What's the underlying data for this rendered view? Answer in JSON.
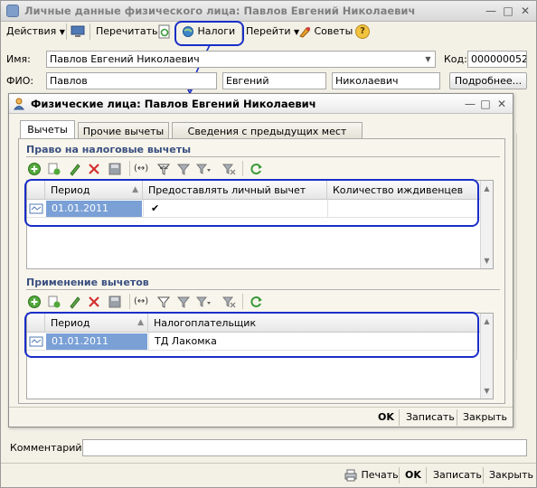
{
  "outer_window": {
    "title": "Личные данные физического лица: Павлов Евгений Николаевич",
    "toolbar": {
      "actions": "Действия",
      "reread": "Перечитать",
      "taxes": "Налоги",
      "go": "Перейти",
      "tips": "Советы",
      "help": "?"
    },
    "name_label": "Имя:",
    "name_value": "Павлов Евгений Николаевич",
    "code_label": "Код:",
    "code_value": "000000052",
    "fio_label": "ФИО:",
    "last_name": "Павлов",
    "first_name": "Евгений",
    "patronymic": "Николаевич",
    "details_button": "Подробнее...",
    "comment_label": "Комментарий:",
    "comment_value": "",
    "bottom": {
      "print": "Печать",
      "ok": "OK",
      "save": "Записать",
      "close": "Закрыть"
    }
  },
  "inner_window": {
    "title": "Физические лица: Павлов Евгений Николаевич",
    "tabs": [
      {
        "label": "Вычеты",
        "active": true
      },
      {
        "label": "Прочие вычеты",
        "active": false
      },
      {
        "label": "Сведения с предыдущих мест работы",
        "active": false
      }
    ],
    "section1": {
      "title": "Право на налоговые вычеты",
      "columns": [
        "Период",
        "Предоставлять личный вычет",
        "Количество иждивенцев"
      ],
      "rows": [
        {
          "period": "01.01.2011",
          "personal_deduction": "✔",
          "dependents": ""
        }
      ]
    },
    "section2": {
      "title": "Применение вычетов",
      "columns": [
        "Период",
        "Налогоплательщик"
      ],
      "rows": [
        {
          "period": "01.01.2011",
          "taxpayer": "ТД Лакомка"
        }
      ]
    },
    "bottom": {
      "ok": "OK",
      "save": "Записать",
      "close": "Закрыть"
    }
  },
  "colors": {
    "highlight": "#1a2ec8",
    "section_title": "#3a4f80",
    "selection": "#7aa0d6"
  }
}
